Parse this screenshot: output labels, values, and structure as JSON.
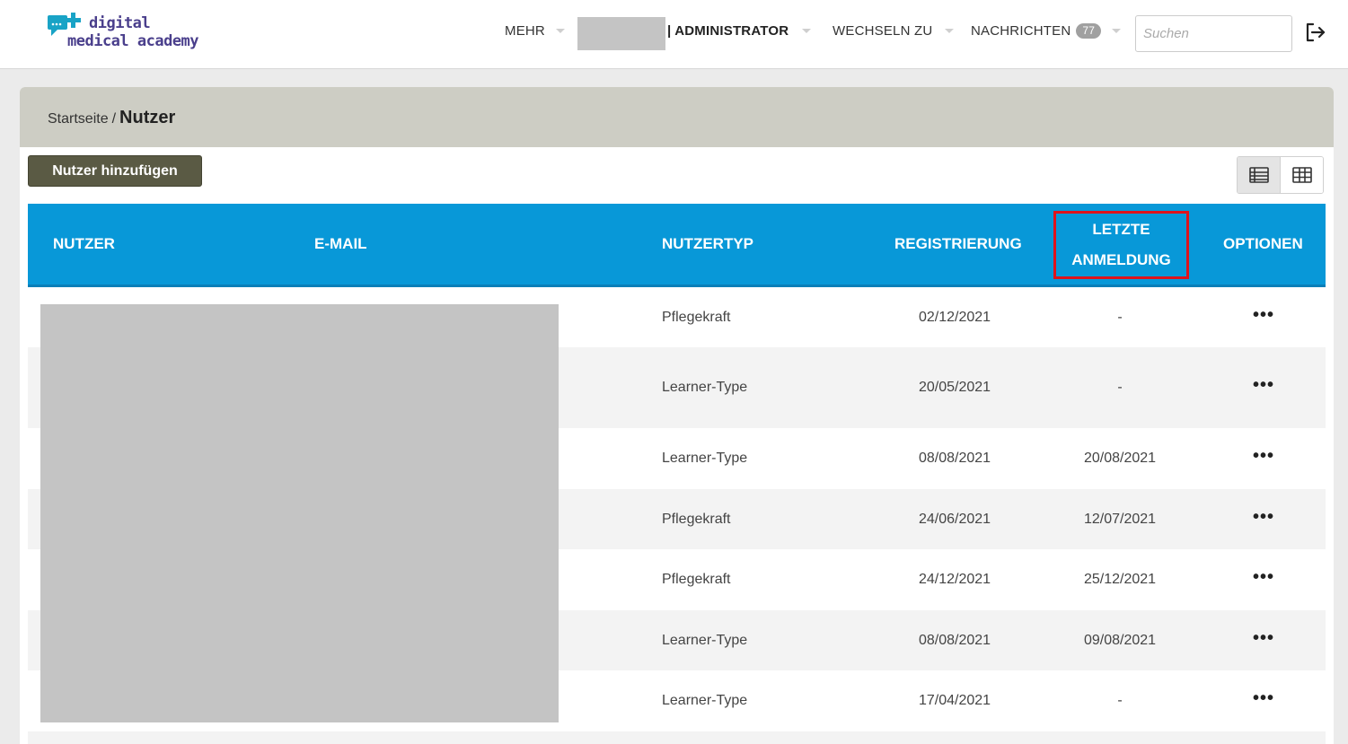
{
  "brand": {
    "line1": "digital",
    "line2": "medical academy"
  },
  "nav": {
    "mehr": "MEHR",
    "admin": "| ADMINISTRATOR",
    "wechseln": "WECHSELN ZU",
    "nachrichten": "NACHRICHTEN",
    "nachrichten_count": "77",
    "search_placeholder": "Suchen"
  },
  "breadcrumb": {
    "home": "Startseite",
    "separator": "/",
    "current": "Nutzer"
  },
  "toolbar": {
    "add_user": "Nutzer hinzufügen"
  },
  "table": {
    "headers": {
      "nutzer": "NUTZER",
      "email": "E-MAIL",
      "nutzertyp": "NUTZERTYP",
      "registrierung": "REGISTRIERUNG",
      "letzte_line1": "LETZTE",
      "letzte_line2": "ANMELDUNG",
      "optionen": "OPTIONEN"
    },
    "rows": [
      {
        "type": "Pflegekraft",
        "registered": "02/12/2021",
        "last_login": "-",
        "options": "•••"
      },
      {
        "type": "Learner-Type",
        "registered": "20/05/2021",
        "last_login": "-",
        "options": "•••"
      },
      {
        "type": "Learner-Type",
        "registered": "08/08/2021",
        "last_login": "20/08/2021",
        "options": "•••"
      },
      {
        "type": "Pflegekraft",
        "registered": "24/06/2021",
        "last_login": "12/07/2021",
        "options": "•••"
      },
      {
        "type": "Pflegekraft",
        "registered": "24/12/2021",
        "last_login": "25/12/2021",
        "options": "•••"
      },
      {
        "type": "Learner-Type",
        "registered": "08/08/2021",
        "last_login": "09/08/2021",
        "options": "•••"
      },
      {
        "type": "Learner-Type",
        "registered": "17/04/2021",
        "last_login": "-",
        "options": "•••"
      }
    ]
  },
  "colors": {
    "header_blue": "#0898d8",
    "highlight_red": "#e0121b",
    "button_dark": "#5a5a44",
    "brand_purple": "#4a3f8c",
    "brand_teal": "#19a3c6"
  }
}
